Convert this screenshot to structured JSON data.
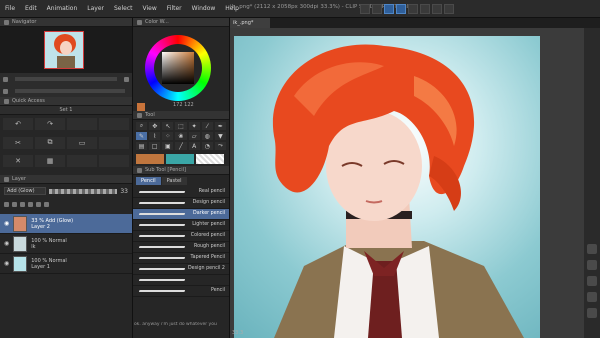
{
  "window": {
    "title": "ik_.png* (2112 x 2058px 300dpi 33.3%) - CLIP STUDIO PAINT PRO",
    "doc_tab": "ik_.png*",
    "zoom": "33.3"
  },
  "menu": [
    "File",
    "Edit",
    "Animation",
    "Layer",
    "Select",
    "View",
    "Filter",
    "Window",
    "Help"
  ],
  "panels": {
    "navigator": "Navigator",
    "quick_access": "Quick Access",
    "set": "Set 1",
    "layer": "Layer",
    "color_wheel": "Color W...",
    "tool": "Tool",
    "sub_tool": "Sub Tool [Pencil]"
  },
  "layer_panel": {
    "blend_mode": "Add (Glow)",
    "opacity": "33",
    "layers": [
      {
        "line1": "33 % Add (Glow)",
        "line2": "Layer 2",
        "selected": true
      },
      {
        "line1": "100 % Normal",
        "line2": "lk",
        "selected": false
      },
      {
        "line1": "100 % Normal",
        "line2": "Layer 1",
        "selected": false
      }
    ]
  },
  "color": {
    "main": "#c8733a",
    "sub": "#ffffff",
    "readout": "172  122",
    "swatch_a": "#c0763e",
    "swatch_b": "#3aa6a6"
  },
  "subtool": {
    "tabs": [
      "Pencil",
      "Pastel"
    ],
    "brushes": [
      "Real pencil",
      "Design pencil",
      "Darker pencil",
      "Lighter pencil",
      "Colored pencil",
      "Rough pencil",
      "Tapered Pencil",
      "Design pencil 2",
      "",
      "Pencil"
    ],
    "selected_index": 2
  },
  "footer": "ok. anyway i'm just do whatever you",
  "icons": [
    "search-icon",
    "gear-icon",
    "eye-icon",
    "lock-icon",
    "pencil-icon",
    "camera-icon",
    "folder-icon",
    "play-icon",
    "settings-icon"
  ]
}
